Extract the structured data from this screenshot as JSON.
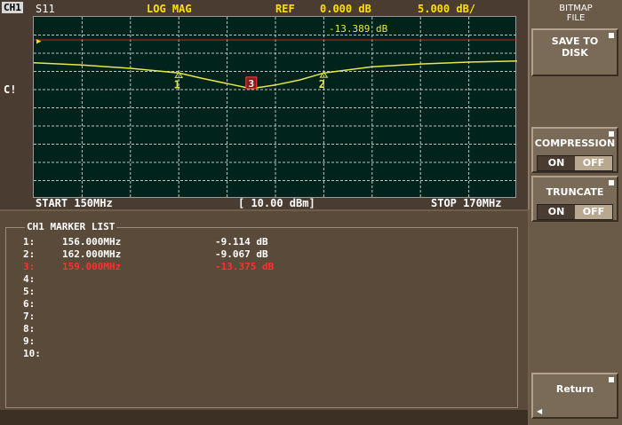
{
  "header": {
    "channel": "CH1",
    "parameter": "S11",
    "format": "LOG MAG",
    "ref_label": "REF",
    "ref_value": "0.000 dB",
    "scale": "5.000 dB/",
    "marker_readout": "-13.389 dB"
  },
  "footer": {
    "start": "START 150MHz",
    "power": "[ 10.00 dBm]",
    "stop": "STOP 170MHz"
  },
  "side_label": "C!",
  "chart_data": {
    "type": "line",
    "x": [
      150,
      152,
      154,
      156,
      157,
      158,
      159,
      160,
      161,
      162,
      164,
      166,
      168,
      170
    ],
    "y": [
      -6.3,
      -6.9,
      -7.8,
      -9.1,
      -10.6,
      -12.0,
      -13.4,
      -12.4,
      -11.0,
      -9.1,
      -7.4,
      -6.6,
      -6.1,
      -5.8
    ],
    "xlim": [
      150,
      170
    ],
    "ylim": [
      -50,
      0
    ],
    "reference_level": 0,
    "markers": [
      {
        "label": "1",
        "x": 156,
        "y": -9.114
      },
      {
        "label": "2",
        "x": 162,
        "y": -9.067
      },
      {
        "label": "3",
        "x": 159,
        "y": -13.375
      }
    ]
  },
  "marker_list": {
    "title": "CH1 MARKER LIST",
    "rows": [
      {
        "index": "1:",
        "freq": "156.000MHz",
        "value": "-9.114 dB",
        "active": false
      },
      {
        "index": "2:",
        "freq": "162.000MHz",
        "value": "-9.067 dB",
        "active": false
      },
      {
        "index": "3:",
        "freq": "159.000MHz",
        "value": "-13.375 dB",
        "active": true
      },
      {
        "index": "4:",
        "freq": "",
        "value": "",
        "active": false
      },
      {
        "index": "5:",
        "freq": "",
        "value": "",
        "active": false
      },
      {
        "index": "6:",
        "freq": "",
        "value": "",
        "active": false
      },
      {
        "index": "7:",
        "freq": "",
        "value": "",
        "active": false
      },
      {
        "index": "8:",
        "freq": "",
        "value": "",
        "active": false
      },
      {
        "index": "9:",
        "freq": "",
        "value": "",
        "active": false
      },
      {
        "index": "10:",
        "freq": "",
        "value": "",
        "active": false
      }
    ]
  },
  "softkeys": {
    "menu_title_1": "BITMAP",
    "menu_title_2": "FILE",
    "save_line1": "SAVE TO",
    "save_line2": "DISK",
    "compression_label": "COMPRESSION",
    "truncate_label": "TRUNCATE",
    "on": "ON",
    "off": "OFF",
    "return_label": "Return"
  },
  "colors": {
    "trace": "#e8e84a",
    "reference_line": "#d02020",
    "active_marker": "#ff3030",
    "graticule": "#ffffff"
  }
}
